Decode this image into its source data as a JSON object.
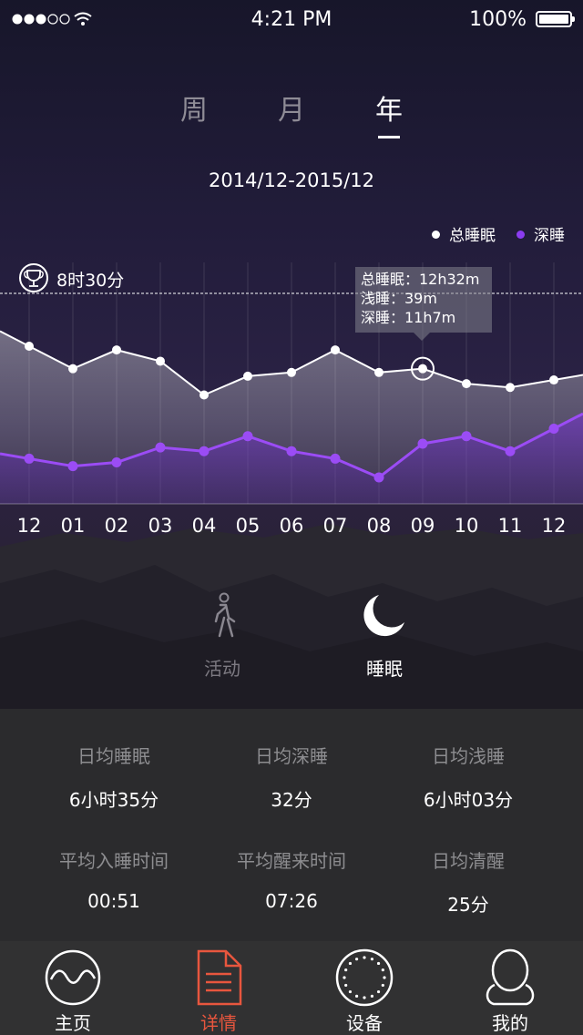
{
  "status_bar": {
    "time": "4:21 PM",
    "battery": "100%"
  },
  "period_tabs": [
    {
      "label": "周",
      "active": false
    },
    {
      "label": "月",
      "active": false
    },
    {
      "label": "年",
      "active": true
    }
  ],
  "date_range": "2014/12-2015/12",
  "legend": [
    {
      "label": "总睡眠",
      "color": "#ffffff"
    },
    {
      "label": "深睡",
      "color": "#8b3cf0"
    }
  ],
  "goal": {
    "label": "8时30分"
  },
  "tooltip": {
    "total": "总睡眠：12h32m",
    "light": "浅睡：39m",
    "deep": "深睡：11h7m"
  },
  "chart_data": {
    "type": "area",
    "categories": [
      "12",
      "01",
      "02",
      "03",
      "04",
      "05",
      "06",
      "07",
      "08",
      "09",
      "10",
      "11",
      "12"
    ],
    "selected_index": 9,
    "series": [
      {
        "name": "总睡眠",
        "color": "#ffffff",
        "values": [
          12.3,
          11.7,
          12.2,
          11.9,
          11.0,
          11.5,
          11.6,
          12.2,
          11.6,
          11.7,
          11.3,
          11.2,
          11.4
        ]
      },
      {
        "name": "深睡",
        "color": "#8b3cf0",
        "values": [
          9.3,
          9.1,
          9.2,
          9.6,
          9.5,
          9.9,
          9.5,
          9.3,
          8.8,
          9.7,
          9.9,
          9.5,
          10.1
        ]
      }
    ],
    "goal": 8.5
  },
  "modes": [
    {
      "label": "活动",
      "active": false,
      "icon": "walking-person-icon"
    },
    {
      "label": "睡眠",
      "active": true,
      "icon": "moon-icon"
    }
  ],
  "stats": [
    {
      "label": "日均睡眠",
      "value": "6小时35分"
    },
    {
      "label": "日均深睡",
      "value": "32分"
    },
    {
      "label": "日均浅睡",
      "value": "6小时03分"
    },
    {
      "label": "平均入睡时间",
      "value": "00:51"
    },
    {
      "label": "平均醒来时间",
      "value": "07:26"
    },
    {
      "label": "日均清醒",
      "value": "25分"
    }
  ],
  "tabbar": [
    {
      "label": "主页",
      "icon": "wave-circle-icon",
      "active": false
    },
    {
      "label": "详情",
      "icon": "document-icon",
      "active": true
    },
    {
      "label": "设备",
      "icon": "device-ring-icon",
      "active": false
    },
    {
      "label": "我的",
      "icon": "user-icon",
      "active": false
    }
  ],
  "colors": {
    "accent": "#e8563e",
    "deep_sleep": "#8b3cf0",
    "stats_bg": "#2b2b2d",
    "tabbar_bg": "#313132"
  }
}
